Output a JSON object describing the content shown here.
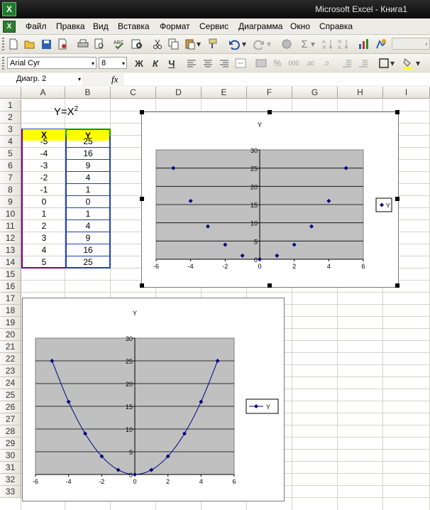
{
  "window": {
    "title": "Microsoft Excel - Книга1"
  },
  "menu": {
    "items": [
      "Файл",
      "Правка",
      "Вид",
      "Вставка",
      "Формат",
      "Сервис",
      "Диаграмма",
      "Окно",
      "Справка"
    ]
  },
  "toolbar": {
    "font_name": "Arial Cyr",
    "font_size": "8",
    "bold": "Ж",
    "italic": "К",
    "underline": "Ч"
  },
  "formula_bar": {
    "name_box": "Диагр. 2",
    "fx": "fx"
  },
  "sheet": {
    "columns": [
      "A",
      "B",
      "C",
      "D",
      "E",
      "F",
      "G",
      "H",
      "I"
    ],
    "rows": [
      "1",
      "2",
      "3",
      "4",
      "5",
      "6",
      "7",
      "8",
      "9",
      "10",
      "11",
      "12",
      "13",
      "14",
      "15",
      "16",
      "17",
      "18",
      "19",
      "20",
      "21",
      "22",
      "23",
      "24",
      "25",
      "26",
      "27",
      "28",
      "29",
      "30",
      "31",
      "32",
      "33"
    ],
    "title_formula": "Y=X",
    "title_exp": "2",
    "header_x": "X",
    "header_y": "Y",
    "x_values": [
      "-5",
      "-4",
      "-3",
      "-2",
      "-1",
      "0",
      "1",
      "2",
      "3",
      "4",
      "5"
    ],
    "y_values": [
      "25",
      "16",
      "9",
      "4",
      "1",
      "0",
      "1",
      "4",
      "9",
      "16",
      "25"
    ]
  },
  "chart_data": [
    {
      "type": "scatter",
      "title": "Y",
      "series": [
        {
          "name": "Y",
          "x": [
            -5,
            -4,
            -3,
            -2,
            -1,
            0,
            1,
            2,
            3,
            4,
            5
          ],
          "y": [
            25,
            16,
            9,
            4,
            1,
            0,
            1,
            4,
            9,
            16,
            25
          ]
        }
      ],
      "xlim": [
        -6,
        6
      ],
      "ylim": [
        0,
        30
      ],
      "xticks": [
        "-6",
        "-4",
        "-2",
        "0",
        "2",
        "4",
        "6"
      ],
      "yticks": [
        "0",
        "5",
        "10",
        "15",
        "20",
        "25",
        "30"
      ],
      "grid": true,
      "legend": "right",
      "line": false,
      "colors": {
        "plot_bg": "#c0c0c0",
        "marker": "#000080"
      }
    },
    {
      "type": "line",
      "title": "Y",
      "series": [
        {
          "name": "Y",
          "x": [
            -5,
            -4,
            -3,
            -2,
            -1,
            0,
            1,
            2,
            3,
            4,
            5
          ],
          "y": [
            25,
            16,
            9,
            4,
            1,
            0,
            1,
            4,
            9,
            16,
            25
          ]
        }
      ],
      "xlim": [
        -6,
        6
      ],
      "ylim": [
        0,
        30
      ],
      "xticks": [
        "-6",
        "-4",
        "-2",
        "0",
        "2",
        "4",
        "6"
      ],
      "yticks": [
        "0",
        "5",
        "10",
        "15",
        "20",
        "25",
        "30"
      ],
      "grid": true,
      "legend": "right",
      "line": true,
      "colors": {
        "plot_bg": "#c0c0c0",
        "marker": "#000080"
      }
    }
  ]
}
